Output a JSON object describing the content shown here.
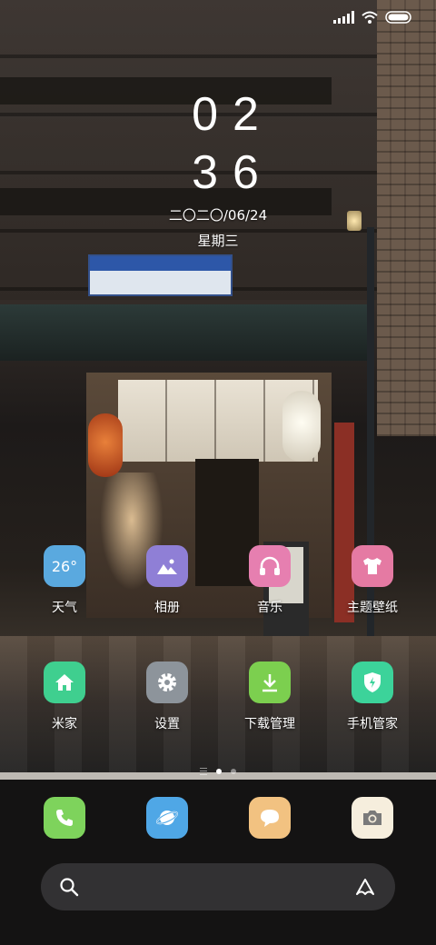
{
  "status_bar": {
    "icons": [
      "signal-icon",
      "wifi-icon",
      "battery-icon"
    ]
  },
  "clock": {
    "hours": "02",
    "minutes": "36",
    "date": "二〇二〇/06/24",
    "weekday": "星期三"
  },
  "apps": [
    {
      "label": "天气",
      "icon": "weather-icon",
      "badge": "26°",
      "color": "#5aa9df"
    },
    {
      "label": "相册",
      "icon": "gallery-icon",
      "color": "#8f7fd6"
    },
    {
      "label": "音乐",
      "icon": "headphones-icon",
      "color": "#e67fb0"
    },
    {
      "label": "主题壁纸",
      "icon": "tshirt-icon",
      "color": "#e57aa3"
    },
    {
      "label": "米家",
      "icon": "home-icon",
      "color": "#3fcf8f"
    },
    {
      "label": "设置",
      "icon": "gear-icon",
      "color": "#8d949b"
    },
    {
      "label": "下载管理",
      "icon": "download-icon",
      "color": "#7ccf4f"
    },
    {
      "label": "手机管家",
      "icon": "shield-icon",
      "color": "#3cd39a"
    }
  ],
  "page_indicator": {
    "pages": 2,
    "current": 1
  },
  "dock": [
    {
      "icon": "phone-icon",
      "color": "#7ed35c"
    },
    {
      "icon": "browser-icon",
      "color": "#4fa7e6"
    },
    {
      "icon": "messages-icon",
      "color": "#f2c281"
    },
    {
      "icon": "camera-icon",
      "color": "#f6eedd"
    }
  ],
  "search": {
    "placeholder": "",
    "icon": "search-icon",
    "assistant_icon": "assistant-icon"
  }
}
